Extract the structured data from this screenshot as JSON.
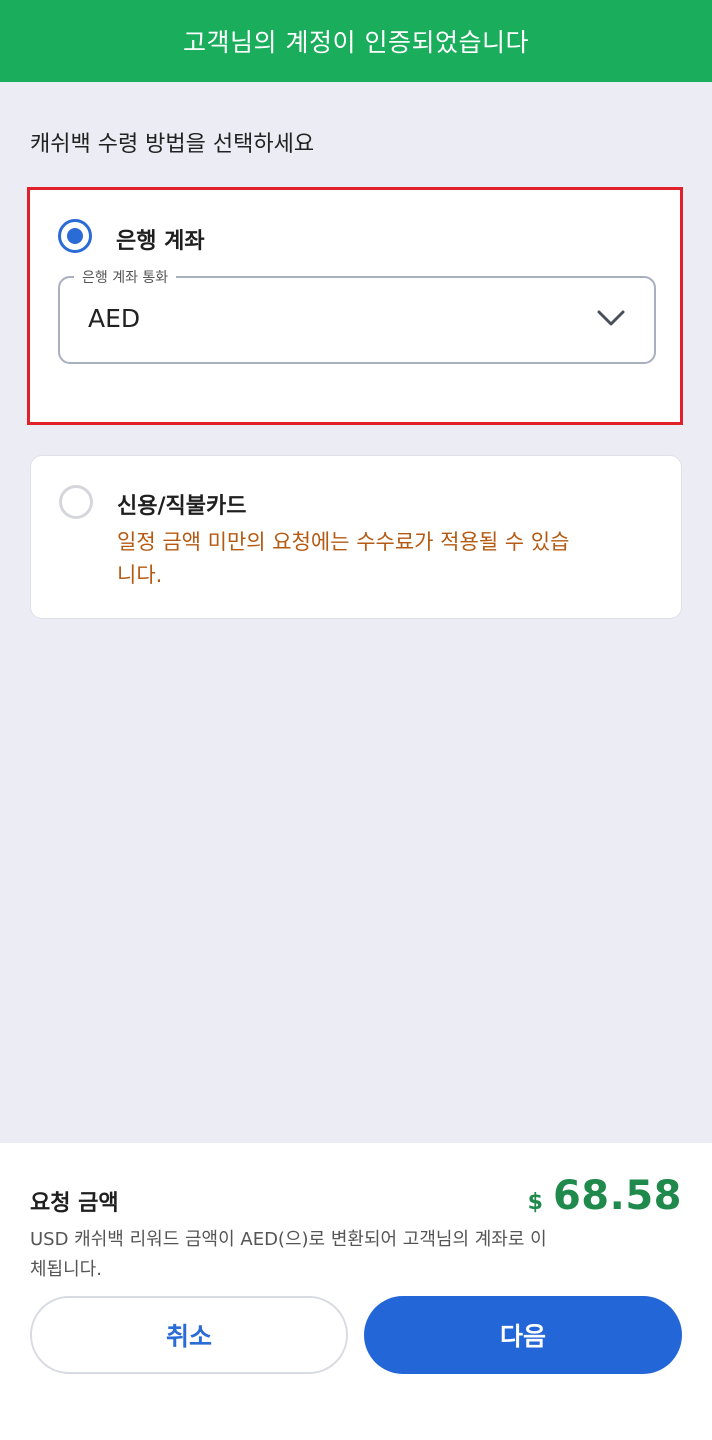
{
  "banner": {
    "text": "고객님의 계정이 인증되었습니다"
  },
  "prompt": "캐쉬백 수령 방법을 선택하세요",
  "options": {
    "bank": {
      "label": "은행 계좌",
      "selected": true,
      "currency_field": {
        "legend": "은행 계좌 통화",
        "value": "AED"
      }
    },
    "card": {
      "label": "신용/직불카드",
      "selected": false,
      "note": "일정 금액 미만의 요청에는 수수료가 적용될 수 있습니다."
    }
  },
  "summary": {
    "label": "요청 금액",
    "currency_symbol": "$",
    "amount": "68.58",
    "description": "USD 캐쉬백 리워드 금액이 AED(으)로 변환되어 고객님의 계좌로 이체됩니다."
  },
  "buttons": {
    "cancel": "취소",
    "next": "다음"
  },
  "colors": {
    "banner_green": "#1aae5c",
    "accent_blue": "#2a6bd6",
    "amount_green": "#1f8a4c",
    "note_orange": "#b45a12",
    "highlight_red": "#e0202a"
  },
  "icons": {
    "radio_selected": "radio-selected-icon",
    "radio_unselected": "radio-unselected-icon",
    "dropdown": "chevron-down-icon"
  }
}
